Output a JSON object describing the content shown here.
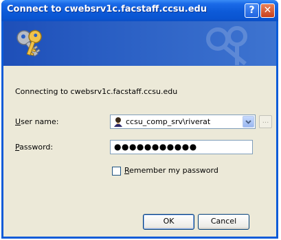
{
  "window": {
    "title": "Connect to cwebsrv1c.facstaff.ccsu.edu",
    "help_label": "?",
    "close_label": "✕"
  },
  "dialog": {
    "connecting_text": "Connecting to cwebsrv1c.facstaff.ccsu.edu",
    "username_label_underlined": "U",
    "username_label_rest": "ser name:",
    "username_value": "ccsu_comp_srv\\riverat",
    "browse_label": "...",
    "password_label_underlined": "P",
    "password_label_rest": "assword:",
    "password_value": "●●●●●●●●●●●",
    "remember_label_underlined": "R",
    "remember_label_rest": "emember my password",
    "remember_checked": false,
    "ok_label": "OK",
    "cancel_label": "Cancel"
  },
  "colors": {
    "titlebar": "#0a55d2",
    "banner": "#2a5fc4",
    "client_bg": "#ece9d8",
    "close_button": "#c8401d"
  },
  "icons": {
    "banner": "keys-icon",
    "user": "user-account-icon",
    "dropdown": "chevron-down-icon"
  }
}
